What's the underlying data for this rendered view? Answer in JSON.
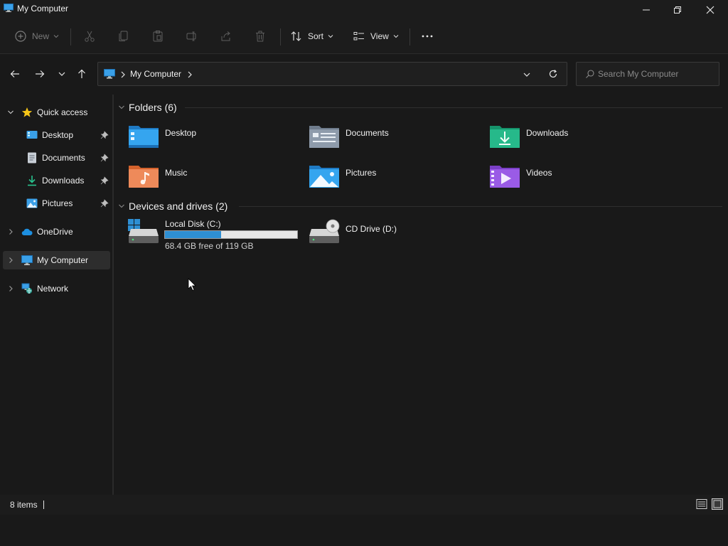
{
  "window": {
    "title": "My Computer",
    "controls": [
      "minimize-icon",
      "restore-icon",
      "close-icon"
    ]
  },
  "toolbar": {
    "new_label": "New",
    "sort_label": "Sort",
    "view_label": "View",
    "icons": [
      "cut-icon",
      "copy-icon",
      "paste-icon",
      "rename-icon",
      "share-icon",
      "delete-icon",
      "more-icon"
    ]
  },
  "address": {
    "location": "My Computer"
  },
  "search": {
    "placeholder": "Search My Computer"
  },
  "sidebar": {
    "quick_access": "Quick access",
    "items": [
      {
        "label": "Desktop",
        "icon": "desktop-icon",
        "pinned": true
      },
      {
        "label": "Documents",
        "icon": "documents-icon",
        "pinned": true
      },
      {
        "label": "Downloads",
        "icon": "downloads-icon",
        "pinned": true
      },
      {
        "label": "Pictures",
        "icon": "pictures-icon",
        "pinned": true
      }
    ],
    "onedrive": "OneDrive",
    "my_computer": "My Computer",
    "network": "Network"
  },
  "content": {
    "folders_heading": "Folders (6)",
    "folders": [
      {
        "name": "Desktop",
        "icon": "desktop-folder-icon"
      },
      {
        "name": "Documents",
        "icon": "documents-folder-icon"
      },
      {
        "name": "Downloads",
        "icon": "downloads-folder-icon"
      },
      {
        "name": "Music",
        "icon": "music-folder-icon"
      },
      {
        "name": "Pictures",
        "icon": "pictures-folder-icon"
      },
      {
        "name": "Videos",
        "icon": "videos-folder-icon"
      }
    ],
    "drives_heading": "Devices and drives (2)",
    "drives": [
      {
        "name": "Local Disk (C:)",
        "free_text": "68.4 GB free of 119 GB",
        "used_fraction": 0.425
      },
      {
        "name": "CD Drive (D:)"
      }
    ]
  },
  "status": {
    "item_count": "8 items"
  },
  "colors": {
    "accent": "#2e8fd3",
    "background": "#191919",
    "selected": "#2d2d2d"
  }
}
